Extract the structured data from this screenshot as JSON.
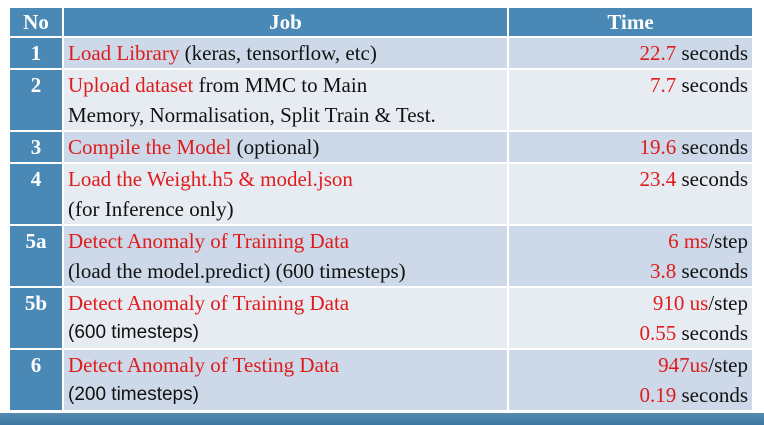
{
  "headers": {
    "no": "No",
    "job": "Job",
    "time": "Time"
  },
  "rows": [
    {
      "no": "1",
      "job_lines": [
        {
          "highlight": "Load Library",
          "rest": " (keras, tensorflow, etc)"
        }
      ],
      "time_lines": [
        {
          "value": "22.7",
          "unit": " seconds"
        }
      ]
    },
    {
      "no": "2",
      "job_lines": [
        {
          "highlight": "Upload dataset",
          "rest": " from MMC to Main"
        },
        {
          "highlight": "",
          "rest": "Memory, Normalisation, Split Train & Test."
        }
      ],
      "time_lines": [
        {
          "value": "7.7",
          "unit": " seconds"
        }
      ]
    },
    {
      "no": "3",
      "job_lines": [
        {
          "highlight": "Compile the Model",
          "rest": " (optional)"
        }
      ],
      "time_lines": [
        {
          "value": "19.6",
          "unit": " seconds"
        }
      ]
    },
    {
      "no": "4",
      "job_lines": [
        {
          "highlight": "Load the Weight.h5 & model.json",
          "rest": ""
        },
        {
          "highlight": "",
          "rest": "(for Inference only)"
        }
      ],
      "time_lines": [
        {
          "value": "23.4",
          "unit": " seconds"
        }
      ]
    },
    {
      "no": "5a",
      "job_lines": [
        {
          "highlight": "Detect Anomaly of Training Data",
          "rest": ""
        },
        {
          "highlight": "",
          "rest": "(load the model.predict) (600 timesteps)"
        }
      ],
      "time_lines": [
        {
          "value": "6 ms",
          "unit": "/step"
        },
        {
          "value": "3.8",
          "unit": " seconds"
        }
      ]
    },
    {
      "no": "5b",
      "job_lines": [
        {
          "highlight": "Detect Anomaly of Training Data",
          "rest": ""
        },
        {
          "highlight": "",
          "rest": "(600 timesteps)"
        }
      ],
      "time_lines": [
        {
          "value": "910 us",
          "unit": "/step"
        },
        {
          "value": "0.55",
          "unit": " seconds"
        }
      ]
    },
    {
      "no": "6",
      "job_lines": [
        {
          "highlight": "Detect Anomaly of Testing Data",
          "rest": ""
        },
        {
          "highlight": "",
          "rest": "(200 timesteps)"
        }
      ],
      "time_lines": [
        {
          "value": "947us",
          "unit": "/step"
        },
        {
          "value": "0.19",
          "unit": " seconds"
        }
      ]
    }
  ],
  "colors": {
    "header_bg": "#4a89b6",
    "row_dark": "#cdd9e8",
    "row_light": "#e7ecf3",
    "highlight": "#e01b1b"
  }
}
